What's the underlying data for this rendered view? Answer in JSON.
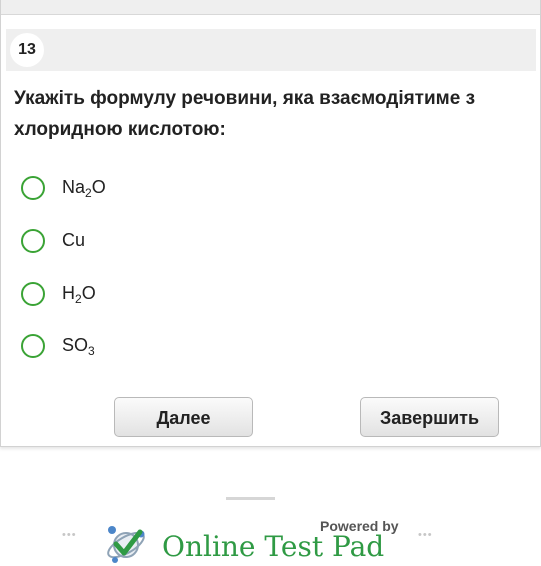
{
  "question": {
    "number": "13",
    "text": "Укажіть формулу речовини, яка взаємодіятиме з хлоридною кислотою:"
  },
  "answers": [
    {
      "base": "Na",
      "sub": "2",
      "tail": "O"
    },
    {
      "base": "Cu",
      "sub": "",
      "tail": ""
    },
    {
      "base": "H",
      "sub": "2",
      "tail": "O"
    },
    {
      "base": "SO",
      "sub": "3",
      "tail": ""
    }
  ],
  "buttons": {
    "next": "Далее",
    "finish": "Завершить"
  },
  "footer": {
    "powered_by": "Powered by",
    "brand": "Online Test Pad",
    "left_dots": "•••",
    "right_dots": "•••"
  },
  "colors": {
    "accent": "#3aa335",
    "brand": "#2f9a44",
    "header_bg": "#efefef"
  }
}
